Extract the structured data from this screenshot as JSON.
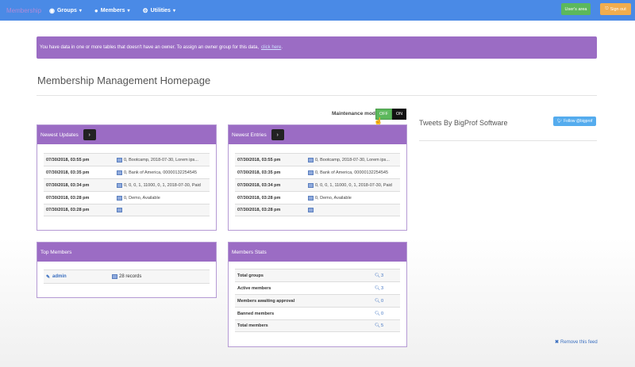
{
  "navbar": {
    "brand": "Membership",
    "items": [
      {
        "label": "Groups",
        "icon": "globe-icon",
        "glyph": "◉"
      },
      {
        "label": "Members",
        "icon": "user-icon",
        "glyph": "👤"
      },
      {
        "label": "Utilities",
        "icon": "gear-icon",
        "glyph": "⚙"
      }
    ],
    "users_area": "User's area",
    "sign_out": "Sign out"
  },
  "alert": {
    "text": "You have data in one or more tables that doesn't have an owner. To assign an owner group for this data,",
    "link": "click here",
    "end": "."
  },
  "page_title": "Membership Management Homepage",
  "maintenance": {
    "label": "Maintenance mode",
    "off": "OFF",
    "on": "ON"
  },
  "newest_updates": {
    "title": "Newest Updates",
    "rows": [
      {
        "date": "07/30/2018, 03:55 pm",
        "text": "0, Bootcamp, 2018-07-30, Lorem ips..."
      },
      {
        "date": "07/30/2018, 03:35 pm",
        "text": "0, Bank of America, 00000132254545"
      },
      {
        "date": "07/30/2018, 03:34 pm",
        "text": "0, 0, 0, 1, 11000, 0, 1, 2018-07-30, Paid"
      },
      {
        "date": "07/30/2018, 03:28 pm",
        "text": "0, Demo, Available"
      },
      {
        "date": "07/30/2018, 03:28 pm",
        "text": ""
      }
    ]
  },
  "newest_entries": {
    "title": "Newest Entries",
    "rows": [
      {
        "date": "07/30/2018, 03:55 pm",
        "text": "0, Bootcamp, 2018-07-30, Lorem ips..."
      },
      {
        "date": "07/30/2018, 03:35 pm",
        "text": "0, Bank of America, 00000132254545"
      },
      {
        "date": "07/30/2018, 03:34 pm",
        "text": "0, 0, 0, 1, 11000, 0, 1, 2018-07-30, Paid"
      },
      {
        "date": "07/30/2018, 03:28 pm",
        "text": "0, Demo, Available"
      },
      {
        "date": "07/30/2018, 03:28 pm",
        "text": ""
      }
    ]
  },
  "top_members": {
    "title": "Top Members",
    "member": {
      "name": "admin",
      "records": "28 records"
    }
  },
  "members_stats": {
    "title": "Members Stats",
    "rows": [
      {
        "label": "Total groups",
        "value": "3"
      },
      {
        "label": "Active members",
        "value": "3"
      },
      {
        "label": "Members awaiting approval",
        "value": "0"
      },
      {
        "label": "Banned members",
        "value": "0"
      },
      {
        "label": "Total members",
        "value": "5"
      }
    ]
  },
  "tweets": {
    "title": "Tweets By BigProf Software",
    "follow": "Follow @bigprof",
    "remove": "Remove this feed"
  }
}
